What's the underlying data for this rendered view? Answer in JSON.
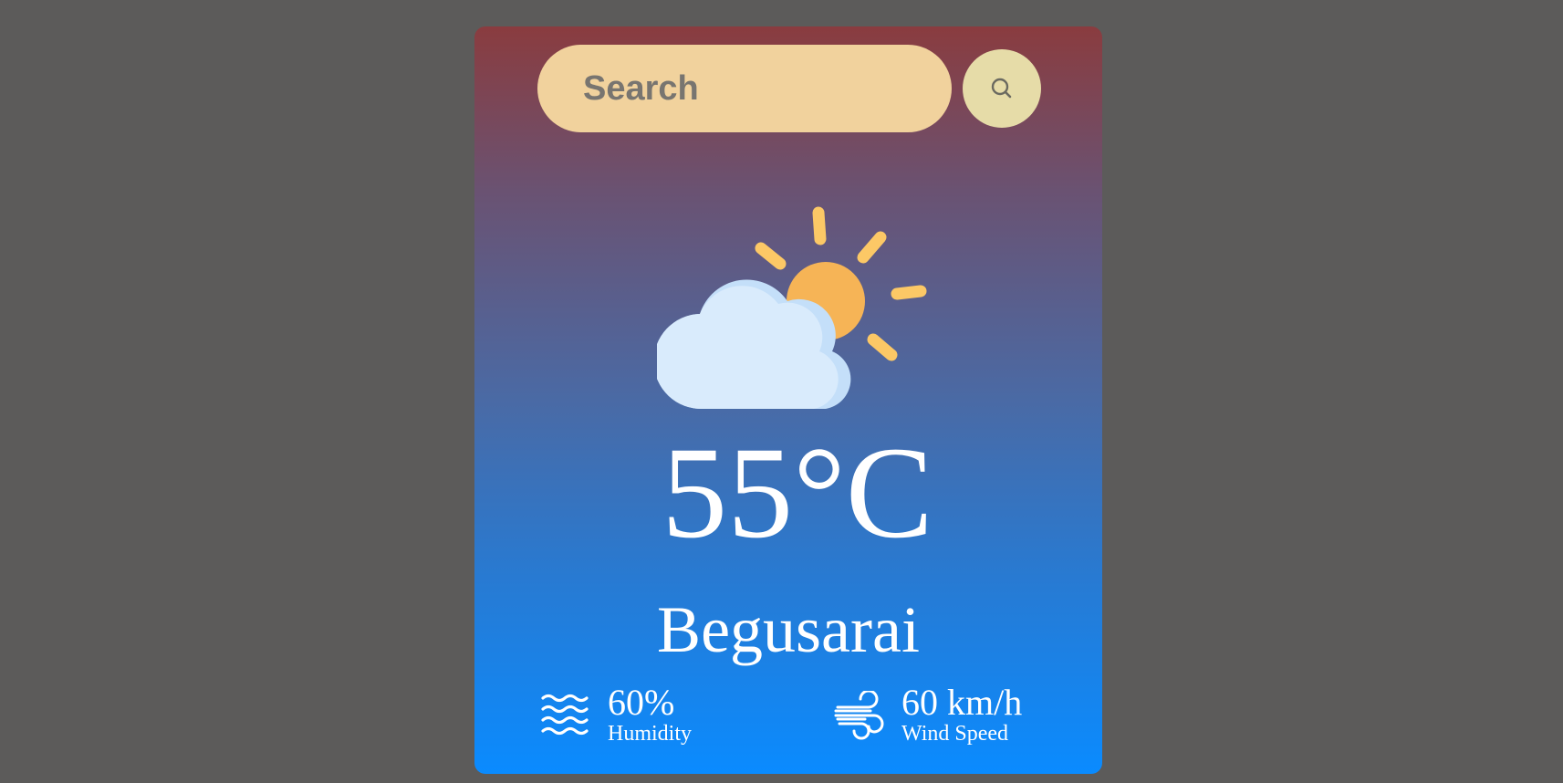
{
  "search": {
    "placeholder": "Search",
    "button_icon": "search-icon"
  },
  "weather": {
    "icon": "partly-cloudy-icon",
    "temperature": "55°C",
    "city": "Begusarai"
  },
  "details": {
    "humidity": {
      "icon": "humidity-icon",
      "value": "60%",
      "label": "Humidity"
    },
    "wind": {
      "icon": "wind-icon",
      "value": "60 km/h",
      "label": "Wind Speed"
    }
  },
  "colors": {
    "page_background": "#5c5b5a",
    "card_gradient_top": "#8a3c3f",
    "card_gradient_bottom": "#0a8bff",
    "search_input_bg": "#f1d29d",
    "search_button_bg": "#e6dca8",
    "sun": "#f6b456",
    "sun_rays": "#fcc866",
    "cloud": "#d9ebfc"
  }
}
